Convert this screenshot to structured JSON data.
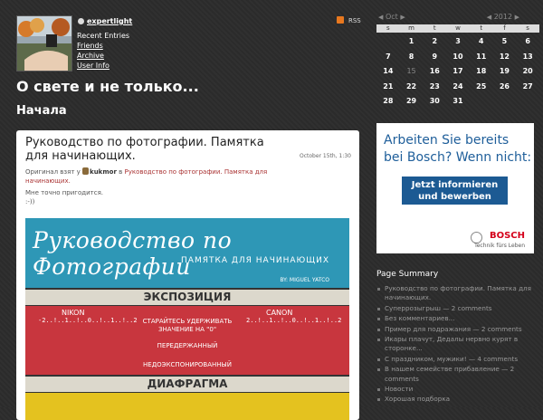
{
  "header": {
    "username": "expertlight",
    "nav": [
      "Recent Entries",
      "Friends",
      "Archive",
      "User Info"
    ],
    "rss_label": "RSS",
    "journal_title": "О свете и не только...",
    "subtitle": "Начала"
  },
  "calendar": {
    "month": "Oct",
    "year": "2012",
    "weekdays": [
      "s",
      "m",
      "t",
      "w",
      "t",
      "f",
      "s"
    ],
    "today": "15",
    "weeks": [
      [
        "",
        "1",
        "2",
        "3",
        "4",
        "5",
        "6"
      ],
      [
        "7",
        "8",
        "9",
        "10",
        "11",
        "12",
        "13"
      ],
      [
        "14",
        "15",
        "16",
        "17",
        "18",
        "19",
        "20"
      ],
      [
        "21",
        "22",
        "23",
        "24",
        "25",
        "26",
        "27"
      ],
      [
        "28",
        "29",
        "30",
        "31",
        "",
        "",
        ""
      ]
    ]
  },
  "post": {
    "title": "Руководство по фотографии. Памятка для начинающих.",
    "date": "October 15th, 1:30",
    "meta_prefix": "Оригинал взят у",
    "original_author": "kukmor",
    "meta_in": "в",
    "original_title": "Руководство по фотографии. Памятка для начинающих.",
    "body_line1": "Мне точно пригодится.",
    "body_line2": ":-))"
  },
  "infographic": {
    "title": "Руководство по Фотографии",
    "subtitle": "ПАМЯТКА ДЛЯ НАЧИНАЮЩИХ",
    "author": "BY: MIGUEL YATCO",
    "section1": "ЭКСПОЗИЦИЯ",
    "brand_left": "NIKON",
    "brand_right": "CANON",
    "hint": "СТАРАЙТЕСЬ УДЕРЖИВАТЬ",
    "hint2": "ЗНАЧЕНИЕ НА \"0\"",
    "overexposed": "ПЕРЕДЕРЖАННЫЙ",
    "underexposed": "НЕДОЭКСПОНИРОВАННЫЙ",
    "scale_l": "-2..!..1..!..0..!..1..!..2",
    "scale_r": "2..!..1..!..0..!..1..!..2",
    "section2": "ДИАФРАГМА"
  },
  "ad": {
    "text": "Arbeiten Sie bereits bei Bosch? Wenn nicht:",
    "button": "Jetzt informieren und bewerben",
    "logo": "BOSCH",
    "tagline": "Technik fürs Leben"
  },
  "summary": {
    "heading": "Page Summary",
    "items": [
      "Руководство по фотографии. Памятка для начинающих.",
      "Суперрозыгрыш — 2 comments",
      "Без комментариев...",
      "Пример для подражания — 2 comments",
      "Икары плачут, Дедалы нервно курят в сторонке...",
      "С праздником, мужики! — 4 comments",
      "В нашем семействе прибавление — 2 comments",
      "Новости",
      "Хорошая подборка"
    ]
  }
}
